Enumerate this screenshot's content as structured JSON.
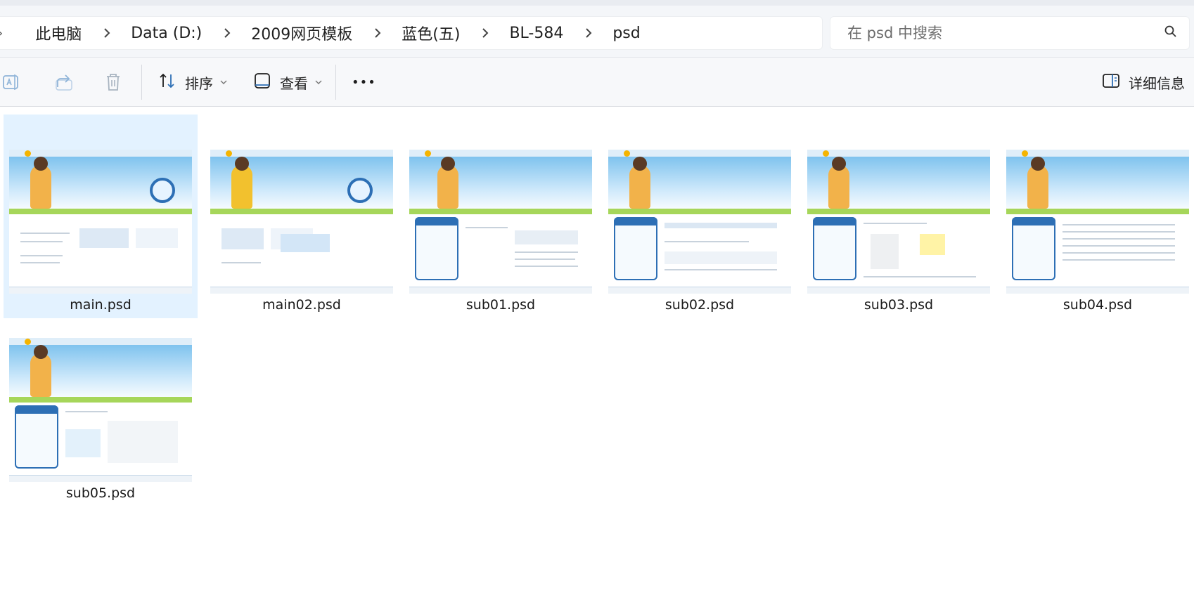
{
  "address": {
    "breadcrumbs": [
      "此电脑",
      "Data (D:)",
      "2009网页模板",
      "蓝色(五)",
      "BL-584",
      "psd"
    ]
  },
  "search": {
    "placeholder": "在 psd 中搜索"
  },
  "toolbar": {
    "sort_label": "排序",
    "view_label": "查看",
    "more_label": "•••",
    "details_label": "详细信息",
    "icons": [
      "rename-icon",
      "share-icon",
      "delete-icon",
      "sort-icon",
      "view-icon",
      "more-icon",
      "details-pane-icon"
    ]
  },
  "files": [
    {
      "name": "main.psd",
      "selected": true
    },
    {
      "name": "main02.psd",
      "selected": false
    },
    {
      "name": "sub01.psd",
      "selected": false
    },
    {
      "name": "sub02.psd",
      "selected": false
    },
    {
      "name": "sub03.psd",
      "selected": false
    },
    {
      "name": "sub04.psd",
      "selected": false
    },
    {
      "name": "sub05.psd",
      "selected": false
    }
  ],
  "colors": {
    "selection": "#cce8ff",
    "accent": "#2d6fb5",
    "toolbar_bg": "#f7f8fa",
    "address_bg": "#f4f6f9"
  }
}
